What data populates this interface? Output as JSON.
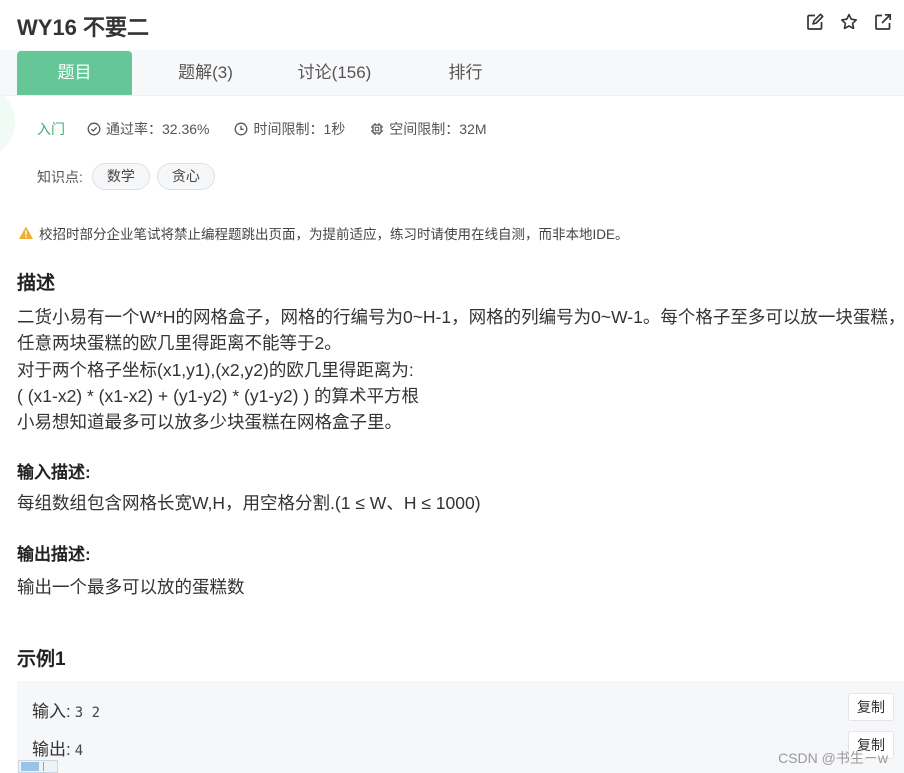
{
  "header": {
    "title": "WY16  不要二",
    "icons": [
      "edit-icon",
      "star-icon",
      "share-icon"
    ]
  },
  "tabs": [
    {
      "label": "题目",
      "active": true
    },
    {
      "label": "题解(3)",
      "active": false
    },
    {
      "label": "讨论(156)",
      "active": false
    },
    {
      "label": "排行",
      "active": false
    }
  ],
  "meta": {
    "level": "入门",
    "pass_rate": "通过率：32.36%",
    "time_limit": "时间限制：1秒",
    "space_limit": "空间限制：32M"
  },
  "knowledge": {
    "label": "知识点:",
    "tags": [
      "数学",
      "贪心"
    ]
  },
  "notice": "校招时部分企业笔试将禁止编程题跳出页面，为提前适应，练习时请使用在线自测，而非本地IDE。",
  "description": {
    "heading": "描述",
    "lines": [
      "二货小易有一个W*H的网格盒子，网格的行编号为0~H-1，网格的列编号为0~W-1。每个格子至多可以放一块蛋糕，",
      "任意两块蛋糕的欧几里得距离不能等于2。",
      "对于两个格子坐标(x1,y1),(x2,y2)的欧几里得距离为:",
      "( (x1-x2) * (x1-x2) + (y1-y2) * (y1-y2) ) 的算术平方根",
      "小易想知道最多可以放多少块蛋糕在网格盒子里。"
    ]
  },
  "input_desc": {
    "heading": "输入描述:",
    "text": "每组数组包含网格长宽W,H，用空格分割.(1 ≤ W、H ≤ 1000)"
  },
  "output_desc": {
    "heading": "输出描述:",
    "text": "输出一个最多可以放的蛋糕数"
  },
  "example": {
    "heading": "示例1",
    "input_label": "输入:",
    "input_value": "3 2",
    "output_label": "输出:",
    "output_value": "4",
    "copy_label": "复制"
  },
  "watermark": "CSDN @书生－w",
  "colors": {
    "accent": "#65c698",
    "level": "#3fae72",
    "warning": "#f0ad2e"
  }
}
